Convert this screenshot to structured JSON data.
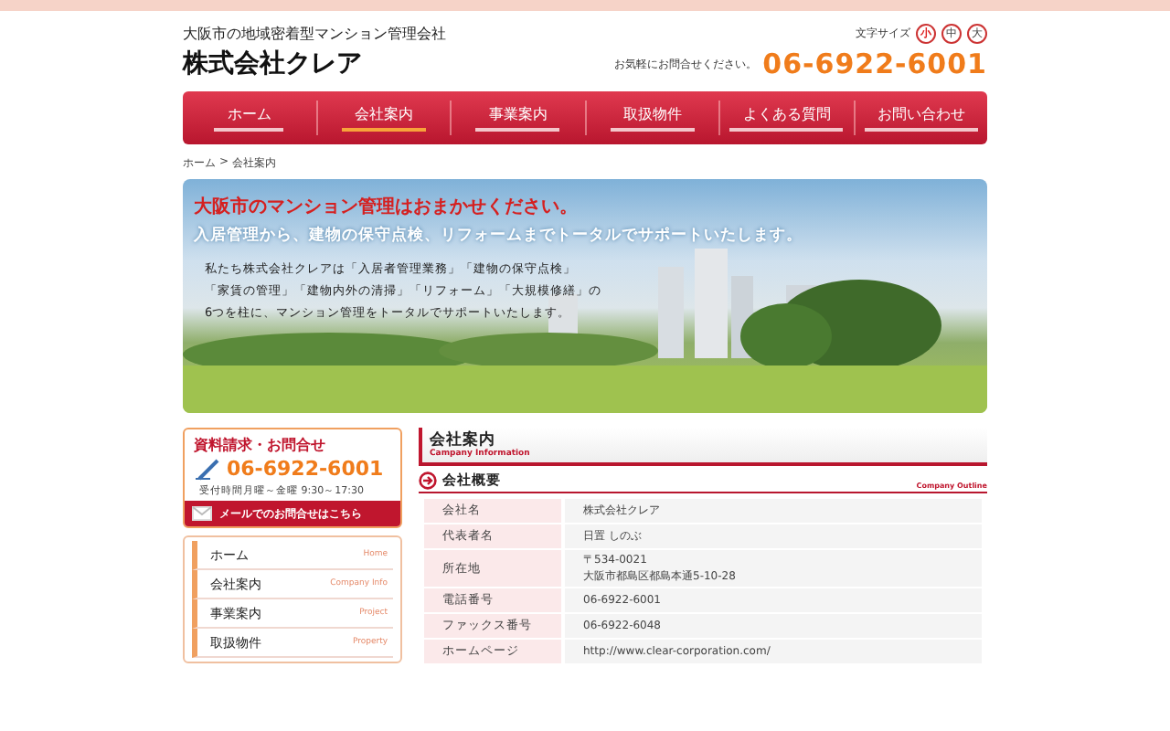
{
  "header": {
    "tagline": "大阪市の地域密着型マンション管理会社",
    "company": "株式会社クレア",
    "font_size_label": "文字サイズ",
    "font_sizes": [
      {
        "label": "小",
        "selected": true
      },
      {
        "label": "中",
        "selected": false
      },
      {
        "label": "大",
        "selected": false
      }
    ],
    "phone_note": "お気軽にお問合せください。",
    "phone": "06-6922-6001"
  },
  "nav": [
    {
      "label": "ホーム",
      "selected": false
    },
    {
      "label": "会社案内",
      "selected": true
    },
    {
      "label": "事業案内",
      "selected": false
    },
    {
      "label": "取扱物件",
      "selected": false
    },
    {
      "label": "よくある質問",
      "selected": false
    },
    {
      "label": "お問い合わせ",
      "selected": false
    }
  ],
  "breadcrumb": [
    "ホーム",
    "会社案内"
  ],
  "breadcrumb_separator": ">",
  "hero": {
    "headline": "大阪市のマンション管理はおまかせください。",
    "subline": "入居管理から、建物の保守点検、リフォームまでトータルでサポートいたします。",
    "body": [
      "私たち株式会社クレアは「入居者管理業務」「建物の保守点検」",
      "「家賃の管理」「建物内外の清掃」「リフォーム」「大規模修繕」の",
      "6つを柱に、マンション管理をトータルでサポートいたします。"
    ]
  },
  "contact": {
    "title": "資料請求・お問合せ",
    "phone": "06-6922-6001",
    "hours": "受付時間月曜～金曜 9:30～17:30",
    "mail_button": "メールでのお問合せはこちら"
  },
  "side_menu": [
    {
      "label": "ホーム",
      "sub": "Home"
    },
    {
      "label": "会社案内",
      "sub": "Company Info"
    },
    {
      "label": "事業案内",
      "sub": "Project"
    },
    {
      "label": "取扱物件",
      "sub": "Property"
    }
  ],
  "page_title": {
    "title": "会社案内",
    "subtitle": "Campany Information"
  },
  "section": {
    "title": "会社概要",
    "subtitle": "Company Outline"
  },
  "table": {
    "rows": [
      {
        "label": "会社名",
        "value": [
          "株式会社クレア"
        ]
      },
      {
        "label": "代表者名",
        "value": [
          "日置 しのぶ"
        ]
      },
      {
        "label": "所在地",
        "value": [
          "〒534-0021",
          "大阪市都島区都島本通5-10-28"
        ]
      },
      {
        "label": "電話番号",
        "value": [
          "06-6922-6001"
        ]
      },
      {
        "label": "ファックス番号",
        "value": [
          "06-6922-6048"
        ]
      },
      {
        "label": "ホームページ",
        "value": [
          "http://www.clear-corporation.com/"
        ]
      }
    ]
  }
}
